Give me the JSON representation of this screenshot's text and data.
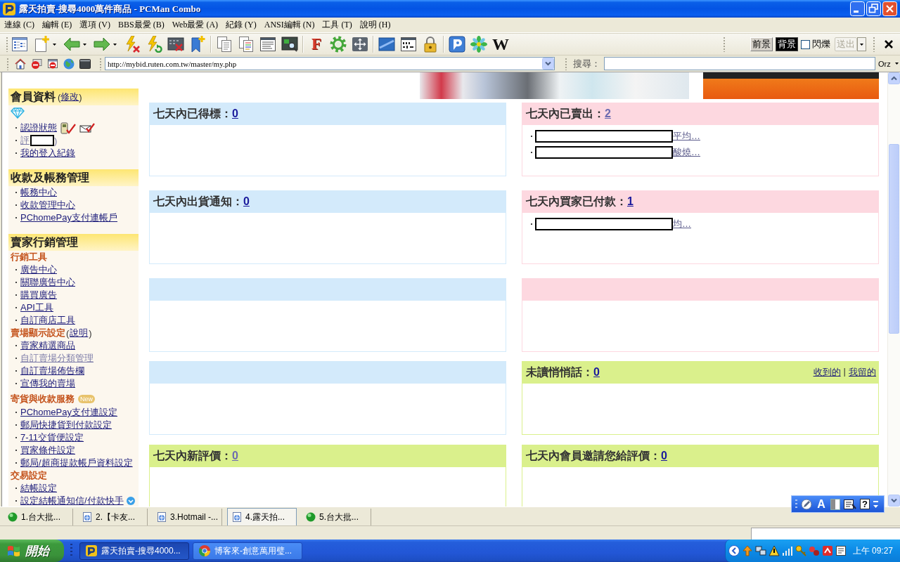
{
  "window": {
    "title": "露天拍賣-搜尋4000萬件商品 - PCMan Combo"
  },
  "menu": [
    "連線 (C)",
    "編輯 (E)",
    "選項 (V)",
    "BBS最愛 (B)",
    "Web最愛 (A)",
    "紀錄 (Y)",
    "ANSI編輯 (N)",
    "工具 (T)",
    "說明 (H)"
  ],
  "toolbar": {
    "font_button": "F",
    "wiki_button": "W",
    "color_buttons": [
      {
        "label": "前景",
        "selected": false
      },
      {
        "label": "背景",
        "selected": true
      }
    ],
    "blink": {
      "label": "閃爍",
      "checked": false
    },
    "send_button": {
      "label": "送出",
      "disabled": true
    }
  },
  "address_bar": {
    "url": "http://mybid.ruten.com.tw/master/my.php",
    "search_label": "搜尋：",
    "encoding": "Orz"
  },
  "sidebar": [
    {
      "title": "會員資料",
      "aside": {
        "prefix": "(",
        "link": "修改",
        "suffix": ")"
      },
      "entries": [
        {
          "kind": "badge"
        },
        {
          "kind": "verified_link",
          "label": "認證狀態",
          "visited": false
        },
        {
          "kind": "redacted_link",
          "label": "評",
          "visited": true,
          "suffix": ")"
        },
        {
          "kind": "link",
          "label": "我的登入紀錄",
          "visited": false
        }
      ]
    },
    {
      "title": "收款及帳務管理",
      "entries": [
        {
          "kind": "link",
          "label": "帳務中心",
          "visited": false
        },
        {
          "kind": "link",
          "label": "收款管理中心",
          "visited": false
        },
        {
          "kind": "link",
          "label": "PChomePay支付連帳戶",
          "visited": false
        }
      ]
    },
    {
      "title": "賣家行銷管理",
      "entries": [
        {
          "kind": "group",
          "label": "行銷工具"
        },
        {
          "kind": "link",
          "label": "廣告中心",
          "visited": false
        },
        {
          "kind": "link",
          "label": "關聯廣告中心",
          "visited": false
        },
        {
          "kind": "link",
          "label": "購買廣告",
          "visited": false
        },
        {
          "kind": "link",
          "label": "API工具",
          "visited": false
        },
        {
          "kind": "link",
          "label": "自訂商店工具",
          "visited": false
        },
        {
          "kind": "group",
          "label": "賣場顯示設定",
          "aside": {
            "prefix": "(",
            "link": "說明",
            "suffix": ")"
          }
        },
        {
          "kind": "link",
          "label": "賣家精選商品",
          "visited": false
        },
        {
          "kind": "link",
          "label": "自訂賣場分類管理",
          "visited": true
        },
        {
          "kind": "link",
          "label": "自訂賣場佈告欄",
          "visited": false
        },
        {
          "kind": "link",
          "label": "宣傳我的賣場",
          "visited": false
        },
        {
          "kind": "group",
          "label": "寄貨與收款服務",
          "badge": "New"
        },
        {
          "kind": "link",
          "label": "PChomePay支付連設定",
          "visited": false
        },
        {
          "kind": "link",
          "label": "郵局快捷貨到付款設定",
          "visited": false
        },
        {
          "kind": "link",
          "label": "7-11交貨便設定",
          "visited": false
        },
        {
          "kind": "link",
          "label": "買家條件設定",
          "visited": false
        },
        {
          "kind": "link",
          "label": "郵局/超商提款帳戶資料設定",
          "visited": false
        },
        {
          "kind": "group",
          "label": "交易設定"
        },
        {
          "kind": "link",
          "label": "結帳設定",
          "visited": false
        },
        {
          "kind": "help_link",
          "label": "設定結帳通知信/付款快手",
          "visited": false
        }
      ]
    }
  ],
  "panels": [
    {
      "title": "七天內已得標：",
      "count": "0",
      "visited": false,
      "color": "#d3eafb"
    },
    {
      "title": "七天內已賣出：",
      "count": "2",
      "visited": true,
      "color": "#fdd8e0",
      "items": [
        {
          "kind": "redacted",
          "text": "平均…"
        },
        {
          "kind": "redacted",
          "text": "酸燒…"
        }
      ]
    },
    {
      "title": "七天內出貨通知：",
      "count": "0",
      "visited": false,
      "color": "#d3eafb"
    },
    {
      "title": "七天內買家已付款：",
      "count": "1",
      "visited": false,
      "color": "#fdd8e0",
      "items": [
        {
          "kind": "redacted",
          "text": "均…"
        }
      ]
    },
    {
      "color": "#d3eafb"
    },
    {
      "color": "#fdd8e0"
    },
    {
      "color": "#d3eafb"
    },
    {
      "title": "未讀悄悄話：",
      "count": "0",
      "visited": false,
      "color": "#daf08c",
      "links": [
        "收到的",
        "我留的"
      ],
      "separator": "|"
    },
    {
      "title": "七天內新評價：",
      "count": "0",
      "visited": true,
      "color": "#daf08c"
    },
    {
      "title": "七天內會員邀請您給評價：",
      "count": "0",
      "visited": false,
      "color": "#daf08c"
    }
  ],
  "tabs": [
    {
      "label": "1.台大批...",
      "kind": "bbs",
      "selected": false
    },
    {
      "label": "2.【卡友...",
      "kind": "web",
      "selected": false
    },
    {
      "label": "3.Hotmail -...",
      "kind": "web",
      "selected": false
    },
    {
      "label": "4.露天拍...",
      "kind": "web",
      "selected": true
    },
    {
      "label": "5.台大批...",
      "kind": "bbs",
      "selected": false
    }
  ],
  "language_bar": {
    "mode": "A",
    "help": "?"
  },
  "taskbar": {
    "start": "開始",
    "tasks": [
      {
        "label": "露天拍賣-搜尋4000...",
        "kind": "pcman",
        "selected": true
      },
      {
        "label": "博客來-創意萬用璧...",
        "kind": "browser",
        "selected": false
      }
    ],
    "clock": "上午 09:27"
  }
}
